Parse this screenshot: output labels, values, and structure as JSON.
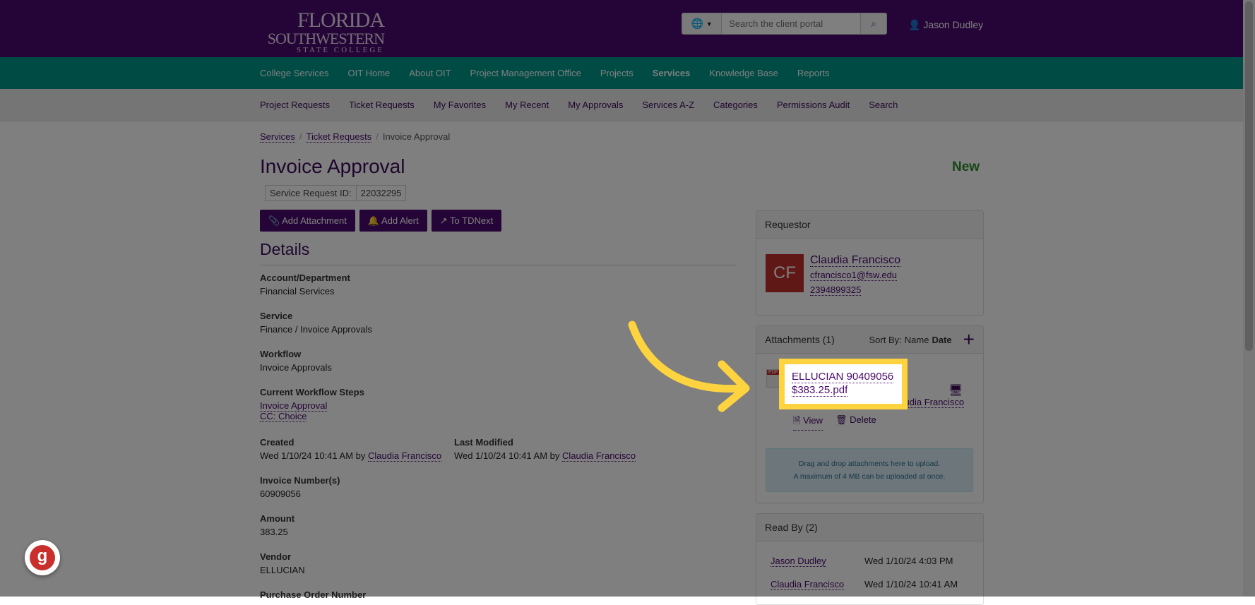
{
  "header": {
    "logo": [
      "FLORIDA",
      "SOUTHWESTERN",
      "STATE COLLEGE"
    ],
    "search_placeholder": "Search the client portal",
    "user": "Jason Dudley"
  },
  "primary_nav": [
    "College Services",
    "OIT Home",
    "About OIT",
    "Project Management Office",
    "Projects",
    "Services",
    "Knowledge Base",
    "Reports"
  ],
  "secondary_nav": [
    "Project Requests",
    "Ticket Requests",
    "My Favorites",
    "My Recent",
    "My Approvals",
    "Services A-Z",
    "Categories",
    "Permissions Audit",
    "Search"
  ],
  "breadcrumb": [
    "Services",
    "Ticket Requests",
    "Invoice Approval"
  ],
  "page": {
    "title": "Invoice Approval",
    "status": "New",
    "srid_label": "Service Request ID:",
    "srid": "22032295"
  },
  "actions": {
    "add_attachment": "Add Attachment",
    "add_alert": "Add Alert",
    "to_tdnext": "To TDNext"
  },
  "details": {
    "heading": "Details",
    "account_label": "Account/Department",
    "account": "Financial Services",
    "service_label": "Service",
    "service": "Finance / Invoice Approvals",
    "workflow_label": "Workflow",
    "workflow": "Invoice Approvals",
    "steps_label": "Current Workflow Steps",
    "steps": [
      "Invoice Approval",
      "CC: Choice"
    ],
    "created_label": "Created",
    "created": "Wed 1/10/24 10:41 AM by",
    "created_by": "Claudia Francisco",
    "modified_label": "Last Modified",
    "modified": "Wed 1/10/24 10:41 AM by",
    "modified_by": "Claudia Francisco",
    "invoice_label": "Invoice Number(s)",
    "invoice": "60909056",
    "amount_label": "Amount",
    "amount": "383.25",
    "vendor_label": "Vendor",
    "vendor": "ELLUCIAN",
    "po_label": "Purchase Order Number"
  },
  "requestor": {
    "heading": "Requestor",
    "initials": "CF",
    "name": "Claudia Francisco",
    "email": "cfrancisco1@fsw.edu",
    "phone": "2394899325"
  },
  "attachments": {
    "heading": "Attachments (1)",
    "sort_label": "Sort By:",
    "sort_name": "Name",
    "sort_date": "Date",
    "file_line1": "ELLUCIAN 90409056",
    "file_line2": "$383.25.pdf",
    "uploader": "Claudia Francisco",
    "view": "View",
    "delete": "Delete",
    "drop_line1": "Drag and drop attachments here to upload.",
    "drop_line2": "A maximum of 4 MB can be uploaded at once."
  },
  "read_by": {
    "heading": "Read By (2)",
    "rows": [
      {
        "name": "Jason Dudley",
        "time": "Wed 1/10/24 4:03 PM"
      },
      {
        "name": "Claudia Francisco",
        "time": "Wed 1/10/24 10:41 AM"
      }
    ]
  },
  "colors": {
    "header": "#4a0a6e",
    "nav": "#00988a",
    "highlight": "#fdd33f",
    "status": "#2e8b2e"
  }
}
